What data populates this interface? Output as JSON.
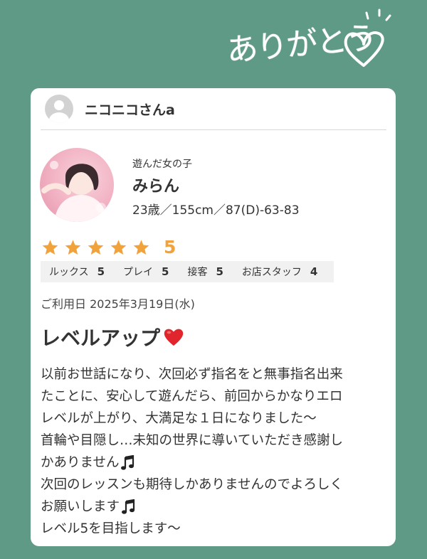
{
  "banner": {
    "text": "ありがとう"
  },
  "reviewer": {
    "name": "ニコニコさんa",
    "avatar_icon": "user-avatar-icon"
  },
  "cast": {
    "label": "遊んだ女の子",
    "name": "みらん",
    "spec": "23歳／155cm／87(D)-63-83"
  },
  "rating": {
    "stars": 5,
    "score": "5",
    "star_color": "#f1a23a",
    "categories": [
      {
        "label": "ルックス",
        "value": "5"
      },
      {
        "label": "プレイ",
        "value": "5"
      },
      {
        "label": "接客",
        "value": "5"
      },
      {
        "label": "お店スタッフ",
        "value": "4"
      }
    ]
  },
  "visit_date": "ご利用日 2025年3月19日(水)",
  "review": {
    "title": "レベルアップ",
    "title_icon": "red-heart-icon",
    "lines": [
      "以前お世話になり、次回必ず指名をと無事指名出来",
      "たことに、安心して遊んだら、前回からかなりエロ",
      "レベルが上がり、大満足な１日になりました〜",
      "首輪や目隠し…未知の世界に導いていただき感謝し",
      "かありません",
      "次回のレッスンも期待しかありませんのでよろしく",
      "お願いします",
      "レベル5を目指します〜"
    ]
  },
  "colors": {
    "background": "#5f9a86",
    "card": "#ffffff",
    "rating_bar": "#f1f1f1",
    "accent_star": "#f1a23a",
    "heart": "#e0262c"
  }
}
